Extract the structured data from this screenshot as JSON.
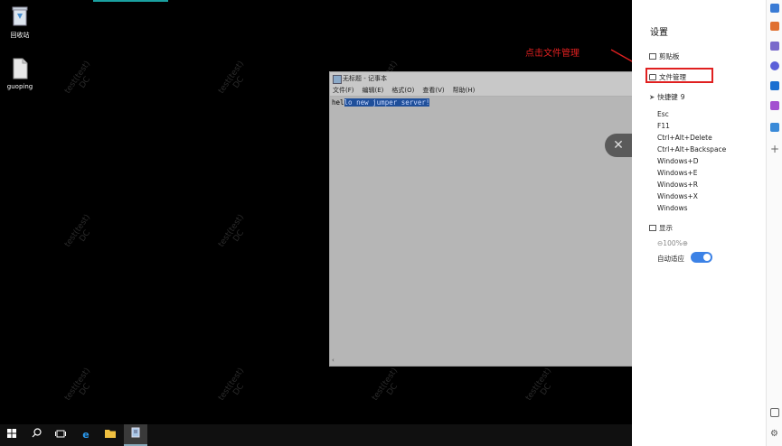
{
  "desktop": {
    "icons": [
      {
        "label": "回收站",
        "icon": "recycle-bin-icon"
      },
      {
        "label": "guoping",
        "icon": "file-icon"
      }
    ],
    "watermark_line1": "test(test)",
    "watermark_line2": "DC"
  },
  "notepad": {
    "title": "无标题 - 记事本",
    "menu": [
      "文件(F)",
      "编辑(E)",
      "格式(O)",
      "查看(V)",
      "帮助(H)"
    ],
    "text_plain": "hel",
    "text_selected": "lo new jumper server!"
  },
  "close_button": {
    "icon": "close-icon",
    "glyph": "✕"
  },
  "annotation": {
    "text": "点击文件管理",
    "color": "#e02020"
  },
  "settings_panel": {
    "title": "设置",
    "clipboard": "剪贴板",
    "file_manager": "文件管理",
    "shortcuts_label": "快捷键",
    "shortcuts_count": "9",
    "shortcuts": [
      "Esc",
      "F11",
      "Ctrl+Alt+Delete",
      "Ctrl+Alt+Backspace",
      "Windows+D",
      "Windows+E",
      "Windows+R",
      "Windows+X",
      "Windows"
    ],
    "display_label": "显示",
    "zoom": "100%",
    "auto_fit_label": "自动适应",
    "auto_fit_on": true,
    "accent": "#3c82e6"
  },
  "taskbar": {
    "items": [
      "start-icon",
      "search-icon",
      "task-view-icon",
      "edge-icon",
      "file-explorer-icon",
      "notepad-icon"
    ]
  }
}
